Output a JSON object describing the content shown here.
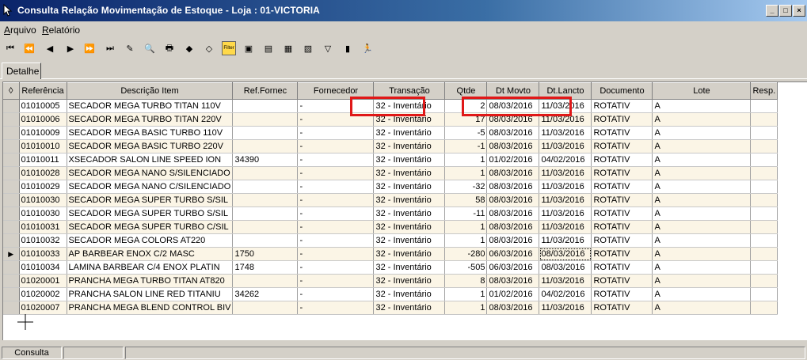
{
  "window": {
    "title": "Consulta Relação Movimentação de Estoque - Loja : 01-VICTORIA"
  },
  "menu": [
    {
      "label_u": "A",
      "label_rest": "rquivo"
    },
    {
      "label_pre": "",
      "label_u": "R",
      "label_rest": "elatório"
    }
  ],
  "tabs": {
    "detalhe": "Detalhe"
  },
  "grid": {
    "columns": [
      "Referência",
      "Descrição Item",
      "Ref.Fornec",
      "Fornecedor",
      "Transação",
      "Qtde",
      "Dt Movto",
      "Dt.Lancto",
      "Documento",
      "Lote",
      "Resp."
    ],
    "rows": [
      [
        "01010005",
        "SECADOR MEGA TURBO TITAN 110V",
        "",
        "-",
        "32 - Inventário",
        "2",
        "08/03/2016",
        "11/03/2016",
        "ROTATIV",
        "A",
        ""
      ],
      [
        "01010006",
        "SECADOR MEGA TURBO TITAN 220V",
        "",
        "-",
        "32 - Inventário",
        "17",
        "08/03/2016",
        "11/03/2016",
        "ROTATIV",
        "A",
        ""
      ],
      [
        "01010009",
        "SECADOR MEGA BASIC TURBO 110V",
        "",
        "-",
        "32 - Inventário",
        "-5",
        "08/03/2016",
        "11/03/2016",
        "ROTATIV",
        "A",
        ""
      ],
      [
        "01010010",
        "SECADOR MEGA BASIC TURBO 220V",
        "",
        "-",
        "32 - Inventário",
        "-1",
        "08/03/2016",
        "11/03/2016",
        "ROTATIV",
        "A",
        ""
      ],
      [
        "01010011",
        "XSECADOR SALON LINE SPEED ION",
        "34390",
        "-",
        "32 - Inventário",
        "1",
        "01/02/2016",
        "04/02/2016",
        "ROTATIV",
        "A",
        ""
      ],
      [
        "01010028",
        "SECADOR MEGA NANO S/SILENCIADO",
        "",
        "-",
        "32 - Inventário",
        "1",
        "08/03/2016",
        "11/03/2016",
        "ROTATIV",
        "A",
        ""
      ],
      [
        "01010029",
        "SECADOR MEGA NANO C/SILENCIADO",
        "",
        "-",
        "32 - Inventário",
        "-32",
        "08/03/2016",
        "11/03/2016",
        "ROTATIV",
        "A",
        ""
      ],
      [
        "01010030",
        "SECADOR MEGA SUPER TURBO S/SIL",
        "",
        "-",
        "32 - Inventário",
        "58",
        "08/03/2016",
        "11/03/2016",
        "ROTATIV",
        "A",
        ""
      ],
      [
        "01010030",
        "SECADOR MEGA SUPER TURBO S/SIL",
        "",
        "-",
        "32 - Inventário",
        "-11",
        "08/03/2016",
        "11/03/2016",
        "ROTATIV",
        "A",
        ""
      ],
      [
        "01010031",
        "SECADOR MEGA SUPER TURBO C/SIL",
        "",
        "-",
        "32 - Inventário",
        "1",
        "08/03/2016",
        "11/03/2016",
        "ROTATIV",
        "A",
        ""
      ],
      [
        "01010032",
        "SECADOR MEGA COLORS AT220",
        "",
        "-",
        "32 - Inventário",
        "1",
        "08/03/2016",
        "11/03/2016",
        "ROTATIV",
        "A",
        ""
      ],
      [
        "01010033",
        "AP BARBEAR ENOX C/2 MASC",
        "1750",
        "-",
        "32 - Inventário",
        "-280",
        "06/03/2016",
        "08/03/2016",
        "ROTATIV",
        "A",
        ""
      ],
      [
        "01010034",
        "LAMINA BARBEAR C/4 ENOX PLATIN",
        "1748",
        "-",
        "32 - Inventário",
        "-505",
        "06/03/2016",
        "08/03/2016",
        "ROTATIV",
        "A",
        ""
      ],
      [
        "01020001",
        "PRANCHA MEGA TURBO TITAN AT820",
        "",
        "-",
        "32 - Inventário",
        "8",
        "08/03/2016",
        "11/03/2016",
        "ROTATIV",
        "A",
        ""
      ],
      [
        "01020002",
        "PRANCHA SALON LINE RED TITANIU",
        "34262",
        "-",
        "32 - Inventário",
        "1",
        "01/02/2016",
        "04/02/2016",
        "ROTATIV",
        "A",
        ""
      ],
      [
        "01020007",
        "PRANCHA MEGA BLEND CONTROL BIV",
        "",
        "-",
        "32 - Inventário",
        "1",
        "08/03/2016",
        "11/03/2016",
        "ROTATIV",
        "A",
        ""
      ]
    ]
  },
  "status": {
    "mode": "Consulta"
  },
  "colors": {
    "highlight": "#e01818",
    "row_alt": "#fbf5e6"
  }
}
